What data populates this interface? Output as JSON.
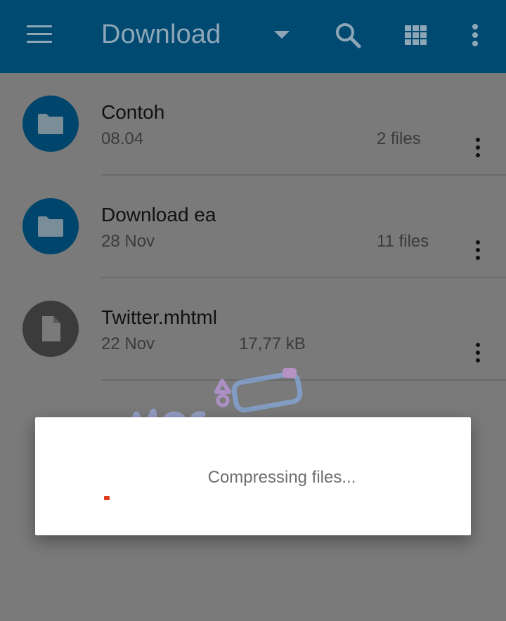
{
  "appbar": {
    "title": "Download",
    "icons": [
      "menu-icon",
      "dropdown-arrow-icon",
      "search-icon",
      "grid-view-icon",
      "more-vert-icon"
    ],
    "background": "#004a72",
    "foreground": "#8ea6b6"
  },
  "items": [
    {
      "type": "folder",
      "name": "Contoh",
      "date": "08.04",
      "meta": "2 files"
    },
    {
      "type": "folder",
      "name": "Download ea",
      "date": "28 Nov",
      "meta": "11 files"
    },
    {
      "type": "file",
      "name": "Twitter.mhtml",
      "date": "22 Nov",
      "meta": "17,77 kB"
    }
  ],
  "dialog": {
    "message": "Compressing files...",
    "spinner_color": "#e03a1a"
  },
  "colors": {
    "folder_avatar": "#00456b",
    "file_avatar": "#3b3b3b",
    "scrim": "#7a7a7a"
  }
}
